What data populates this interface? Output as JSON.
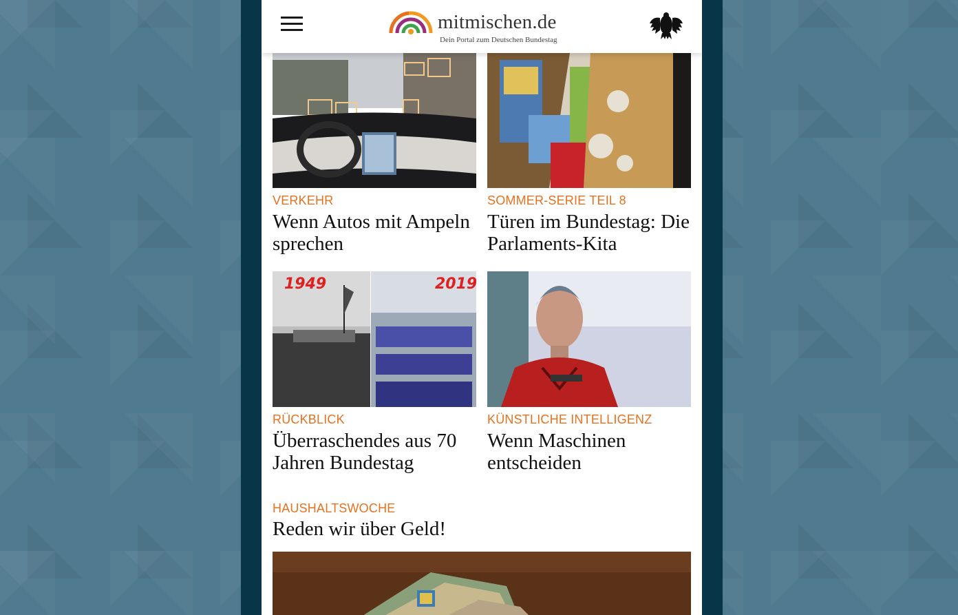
{
  "header": {
    "logo_text": "mitmischen.de",
    "logo_subtitle": "Dein Portal zum Deutschen Bundestag",
    "menu_icon": "hamburger-menu-icon",
    "emblem_icon": "bundestag-eagle-icon"
  },
  "colors": {
    "kicker": "#e8711e",
    "headline": "#111111",
    "frame": "#083648",
    "background": "#4f7a8f"
  },
  "articles": [
    {
      "kicker": "VERKEHR",
      "headline": "Wenn Autos mit Ampeln sprechen"
    },
    {
      "kicker": "SOMMER-SERIE TEIL 8",
      "headline": "Türen im Bundestag: Die Parlaments-Kita"
    },
    {
      "kicker": "RÜCKBLICK",
      "headline": "Überraschendes aus 70 Jahren Bundestag",
      "image_labels": [
        "1949",
        "2019"
      ]
    },
    {
      "kicker": "KÜNSTLICHE INTELLIGENZ",
      "headline": "Wenn Maschinen entscheiden"
    },
    {
      "kicker": "HAUSHALTSWOCHE",
      "headline": "Reden wir über Geld!"
    }
  ]
}
